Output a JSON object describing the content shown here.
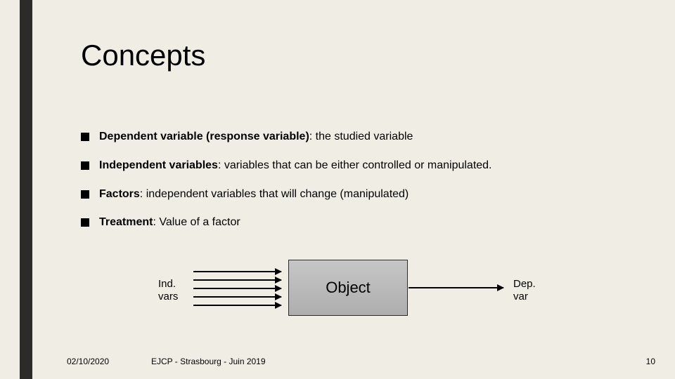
{
  "title": "Concepts",
  "bullets": [
    {
      "bold": "Dependent variable (response variable)",
      "rest": ": the studied variable"
    },
    {
      "bold": "Independent variables",
      "rest": ": variables that can be either controlled or manipulated."
    },
    {
      "bold": "Factors",
      "rest": ": independent variables that will change (manipulated)"
    },
    {
      "bold": "Treatment",
      "rest": ": Value of a factor"
    }
  ],
  "diagram": {
    "ind_label_l1": "Ind.",
    "ind_label_l2": "vars",
    "object_label": "Object",
    "dep_label_l1": "Dep.",
    "dep_label_l2": "var"
  },
  "footer": {
    "date": "02/10/2020",
    "center": "EJCP - Strasbourg - Juin 2019",
    "page": "10"
  }
}
